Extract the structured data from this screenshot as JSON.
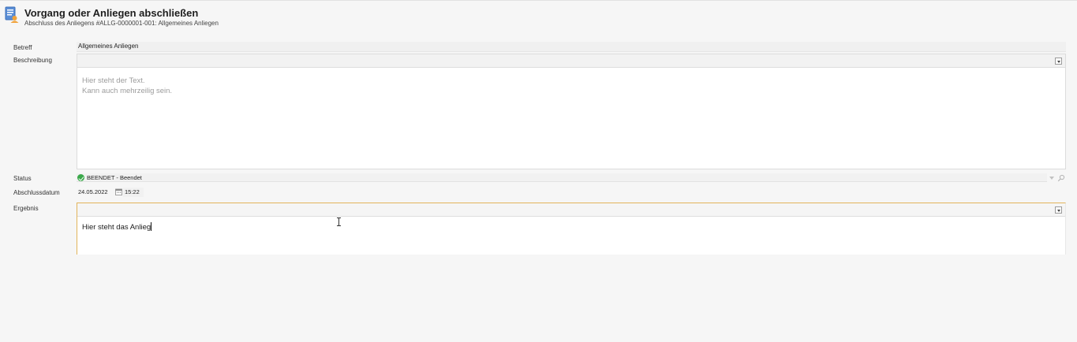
{
  "header": {
    "icon": "form-document-icon",
    "title": "Vorgang oder Anliegen abschließen",
    "subtitle": "Abschluss des Anliegens #ALLG-0000001-001: Allgemeines Anliegen"
  },
  "form": {
    "betreff": {
      "label": "Betreff",
      "value": "Allgemeines Anliegen"
    },
    "beschreibung": {
      "label": "Beschreibung",
      "lines": [
        "Hier steht der Text.",
        "Kann auch mehrzeilig sein."
      ]
    },
    "status": {
      "label": "Status",
      "value": "BEENDET - Beendet",
      "icon": "check-circle-icon",
      "color": "#3aa84a"
    },
    "abschlussdatum": {
      "label": "Abschlussdatum",
      "date": "24.05.2022",
      "time": "15:22"
    },
    "ergebnis": {
      "label": "Ergebnis",
      "value": "Hier steht das Anlieg",
      "focus_color": "#e2b45a"
    }
  }
}
